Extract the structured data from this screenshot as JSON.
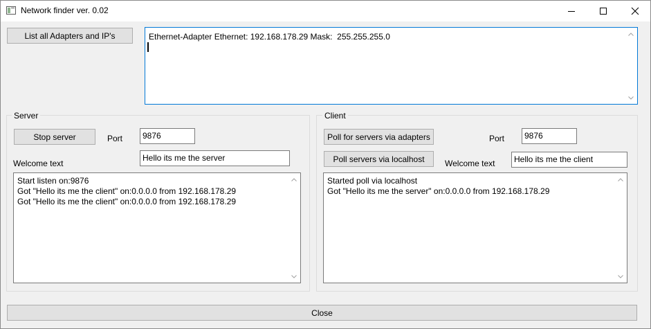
{
  "window": {
    "title": "Network finder ver. 0.02",
    "controls": [
      "minimize-icon",
      "maximize-icon",
      "close-icon"
    ],
    "accent_color": "#0078d7"
  },
  "top": {
    "list_button_label": "List all Adapters and IP's",
    "adapters_output": "Ethernet-Adapter Ethernet: 192.168.178.29 Mask:  255.255.255.0"
  },
  "server": {
    "group_label": "Server",
    "stop_button_label": "Stop server",
    "port_label": "Port",
    "port_value": "9876",
    "welcome_label": "Welcome text",
    "welcome_value": "Hello its me the server",
    "log": [
      "Start listen on:9876",
      "Got \"Hello its me the client\" on:0.0.0.0 from 192.168.178.29",
      "Got \"Hello its me the client\" on:0.0.0.0 from 192.168.178.29"
    ]
  },
  "client": {
    "group_label": "Client",
    "poll_adapters_label": "Poll for servers via adapters",
    "poll_localhost_label": "Poll servers via localhost",
    "port_label": "Port",
    "port_value": "9876",
    "welcome_label": "Welcome text",
    "welcome_value": "Hello its me the client",
    "log": [
      "Started poll via localhost",
      "Got \"Hello its me the server\" on:0.0.0.0 from 192.168.178.29"
    ]
  },
  "footer": {
    "close_label": "Close"
  }
}
